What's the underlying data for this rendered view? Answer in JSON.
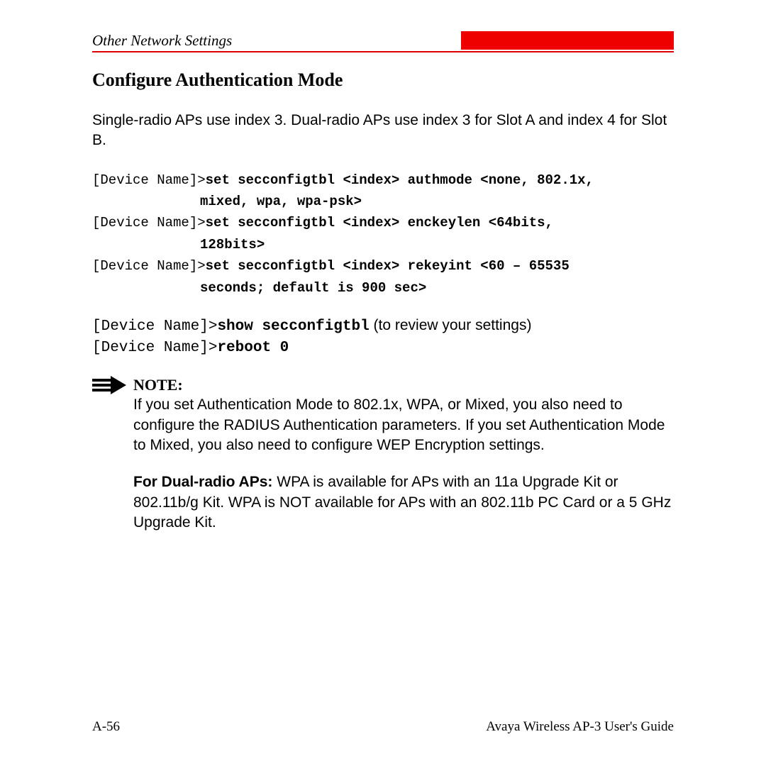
{
  "header": {
    "breadcrumb": "Other Network Settings"
  },
  "title": "Configure Authentication Mode",
  "intro": "Single-radio APs use index 3. Dual-radio APs use index 3 for Slot A and index 4 for Slot B.",
  "cmd": {
    "prompt1": "[Device Name]>",
    "c1": "set secconfigtbl <index> authmode <none, 802.1x,",
    "c1b": "mixed, wpa, wpa-psk>",
    "prompt2": "[Device Name]>",
    "c2": "set secconfigtbl <index> enckeylen <64bits,",
    "c2b": "128bits>",
    "prompt3": "[Device Name]>",
    "c3": "set secconfigtbl <index> rekeyint <60 – 65535",
    "c3b": "seconds; default is 900 sec>"
  },
  "review": {
    "prompt1": "[Device Name]>",
    "cmd1": "show secconfigtbl",
    "tail1": " (to review your settings)",
    "prompt2": "[Device Name]>",
    "cmd2": "reboot 0"
  },
  "note": {
    "label": "NOTE:",
    "p1": "If you set Authentication Mode to 802.1x, WPA, or Mixed, you also need to configure the RADIUS Authentication parameters. If you set Authentication Mode to Mixed, you also need to configure WEP Encryption settings.",
    "dual_label": "For Dual-radio APs: ",
    "p2": "WPA is available for APs with an 11a Upgrade Kit or 802.11b/g Kit. WPA is NOT available for APs with an 802.11b PC Card or a 5 GHz Upgrade Kit."
  },
  "footer": {
    "page": "A-56",
    "doc": "Avaya Wireless AP-3 User's Guide"
  }
}
